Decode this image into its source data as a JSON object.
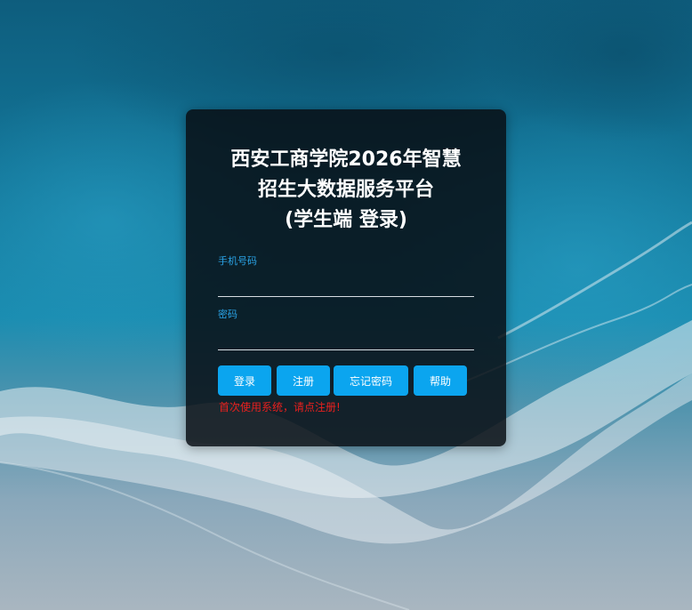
{
  "login_card": {
    "title_lines": [
      "西安工商学院2026年智慧",
      "招生大数据服务平台",
      "(学生端 登录)"
    ],
    "phone_label": "手机号码",
    "phone_value": "",
    "password_label": "密码",
    "password_value": "",
    "buttons": {
      "login": "登录",
      "register": "注册",
      "forgot_password": "忘记密码",
      "help": "帮助"
    },
    "notice": "首次使用系统，请点注册!"
  },
  "colors": {
    "accent": "#0ba5ef",
    "label": "#2aa3e6",
    "notice": "#e8201e",
    "card_background": "#080e14"
  }
}
